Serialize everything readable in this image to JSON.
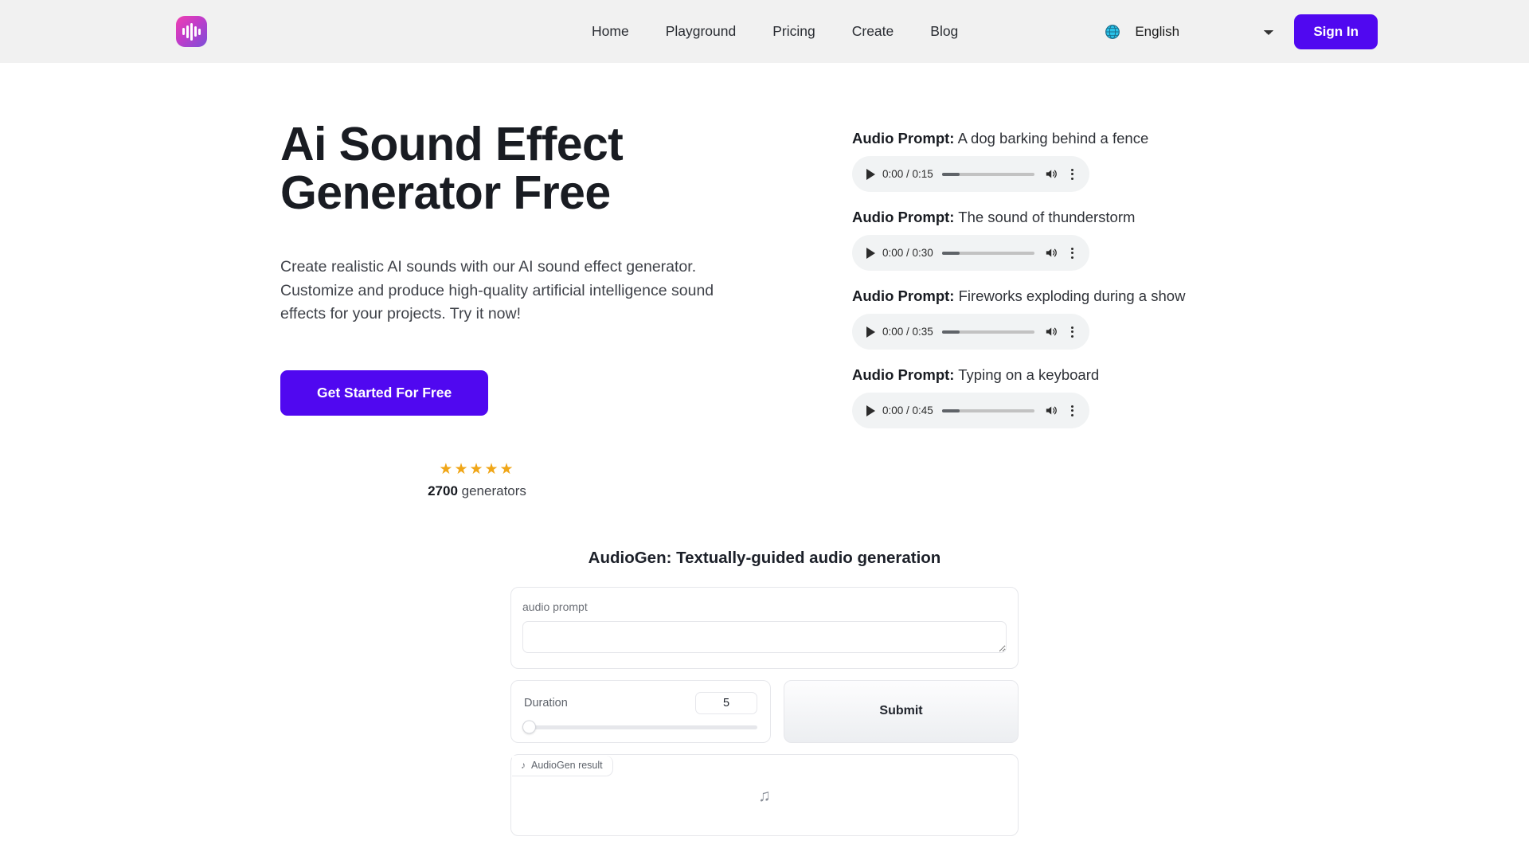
{
  "header": {
    "logo_icon": "audio-waveform-logo",
    "nav": [
      {
        "label": "Home"
      },
      {
        "label": "Playground"
      },
      {
        "label": "Pricing"
      },
      {
        "label": "Create"
      },
      {
        "label": "Blog"
      }
    ],
    "globe_icon": "globe-icon",
    "language": {
      "selected": "English",
      "options": [
        "English"
      ]
    },
    "signin_label": "Sign In",
    "accent_color": "#5008f0",
    "background_color": "#f1f1f1"
  },
  "hero": {
    "title_line1": "Ai Sound Effect",
    "title_line2": "Generator Free",
    "subtitle": "Create realistic AI sounds with our AI sound effect generator. Customize and produce high-quality artificial intelligence sound effects for your projects. Try it now!",
    "cta_label": "Get Started For Free",
    "rating": {
      "stars": "★★★★★",
      "star_count": 5,
      "star_color": "#f0a617",
      "count": "2700",
      "count_suffix": "generators"
    }
  },
  "samples": {
    "prompt_prefix": "Audio Prompt:",
    "items": [
      {
        "prompt": "A dog barking behind a fence",
        "current_time": "0:00",
        "duration": "0:15",
        "time_display": "0:00 / 0:15"
      },
      {
        "prompt": "The sound of thunderstorm",
        "current_time": "0:00",
        "duration": "0:30",
        "time_display": "0:00 / 0:30"
      },
      {
        "prompt": "Fireworks exploding during a show",
        "current_time": "0:00",
        "duration": "0:35",
        "time_display": "0:00 / 0:35"
      },
      {
        "prompt": "Typing on a keyboard",
        "current_time": "0:00",
        "duration": "0:45",
        "time_display": "0:00 / 0:45"
      }
    ],
    "player_icons": {
      "play": "play-icon",
      "volume": "volume-icon",
      "menu": "more-options-icon"
    }
  },
  "generator": {
    "title": "AudioGen: Textually-guided audio generation",
    "prompt_field": {
      "label": "audio prompt",
      "value": "",
      "placeholder": ""
    },
    "duration": {
      "label": "Duration",
      "value": "5",
      "slider_position_percent": 0
    },
    "submit_label": "Submit",
    "result": {
      "tab_label": "AudioGen result",
      "tab_icon": "music-note-icon",
      "placeholder_icon": "music-note-icon",
      "placeholder_glyph": "♫",
      "content": ""
    }
  }
}
